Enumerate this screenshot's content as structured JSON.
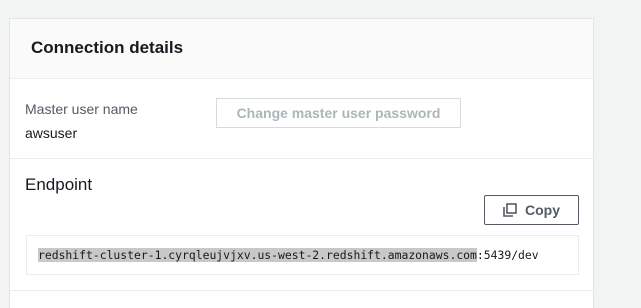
{
  "panel": {
    "title": "Connection details"
  },
  "master_user": {
    "label": "Master user name",
    "value": "awsuser",
    "change_password_label": "Change master user password"
  },
  "endpoint": {
    "title": "Endpoint",
    "copy_label": "Copy",
    "host": "redshift-cluster-1.cyrqleujvjxv.us-west-2.redshift.amazonaws.com",
    "port_db": ":5439/dev",
    "copy_icon": "copy-icon"
  }
}
